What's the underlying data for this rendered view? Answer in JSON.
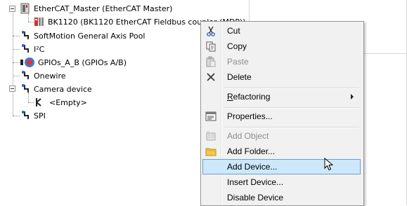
{
  "tree": {
    "items": [
      {
        "label": "EtherCAT_Master (EtherCAT Master)",
        "icon": "ethercat-master-icon"
      },
      {
        "label": "BK1120 (BK1120 EtherCAT Fieldbus coupler (MDP))",
        "icon": "coupler-icon"
      },
      {
        "label": "SoftMotion General Axis Pool",
        "icon": "device-icon"
      },
      {
        "label": "I²C",
        "icon": "device-icon"
      },
      {
        "label": "GPIOs_A_B (GPIOs A/B)",
        "icon": "gpio-icon"
      },
      {
        "label": "Onewire",
        "icon": "device-icon"
      },
      {
        "label": "Camera device",
        "icon": "device-icon"
      },
      {
        "label": "<Empty>",
        "icon": "empty-slot-icon"
      },
      {
        "label": "SPI",
        "icon": "device-icon"
      }
    ]
  },
  "context_menu": {
    "items": [
      {
        "label": "Cut",
        "icon": "scissors-icon",
        "enabled": true
      },
      {
        "label": "Copy",
        "icon": "copy-icon",
        "enabled": true
      },
      {
        "label": "Paste",
        "icon": "paste-icon",
        "enabled": false
      },
      {
        "label": "Delete",
        "icon": "delete-icon",
        "enabled": true
      },
      {
        "label": "Refactoring",
        "icon": "",
        "enabled": true,
        "submenu": true
      },
      {
        "label": "Properties...",
        "icon": "properties-icon",
        "enabled": true
      },
      {
        "label": "Add Object",
        "icon": "add-object-icon",
        "enabled": false
      },
      {
        "label": "Add Folder...",
        "icon": "folder-icon",
        "enabled": true
      },
      {
        "label": "Add Device...",
        "icon": "",
        "enabled": true,
        "highlighted": true
      },
      {
        "label": "Insert Device...",
        "icon": "",
        "enabled": true
      },
      {
        "label": "Disable Device",
        "icon": "",
        "enabled": true
      }
    ]
  },
  "colors": {
    "menu_background": "#f1f1f1",
    "highlight_background": "#cde8fb",
    "highlight_border": "#6a9fd0",
    "disabled_text": "#8d8d8d"
  }
}
